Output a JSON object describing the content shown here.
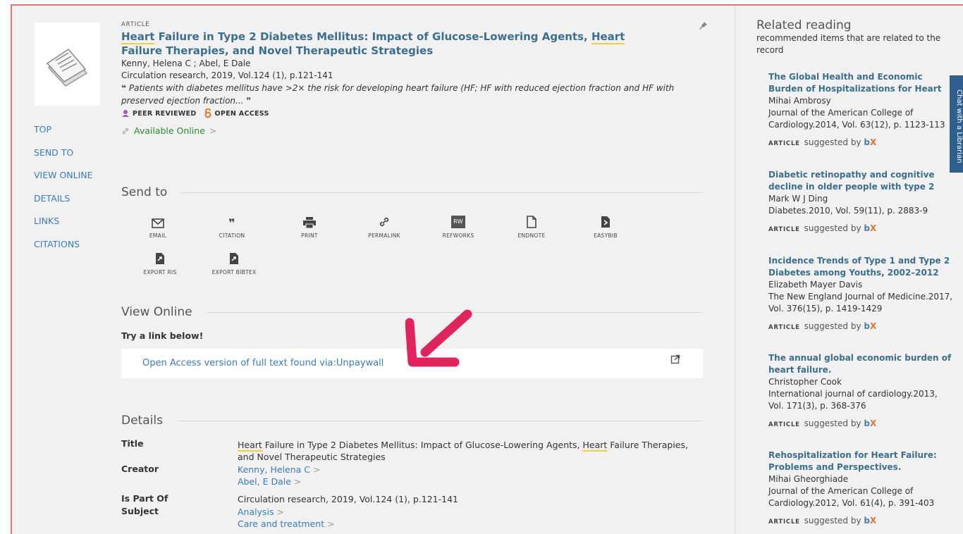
{
  "leftnav": [
    "TOP",
    "SEND TO",
    "VIEW ONLINE",
    "DETAILS",
    "LINKS",
    "CITATIONS"
  ],
  "record": {
    "type": "ARTICLE",
    "title_hl1": "Heart",
    "title_mid": " Failure in Type 2 Diabetes Mellitus: Impact of Glucose-Lowering Agents, ",
    "title_hl2": "Heart",
    "title_end": "Failure Therapies, and Novel Therapeutic Strategies",
    "authors": "Kenny, Helena C ; Abel, E Dale",
    "source": "Circulation research, 2019, Vol.124 (1), p.121-141",
    "snippet": " Patients with diabetes mellitus have >2× the risk for developing heart failure (HF; HF with reduced ejection fraction and HF with preserved ejection fraction... ",
    "open_quote": "❝",
    "close_quote": "❞",
    "badge_peer": "PEER REVIEWED",
    "badge_open": "OPEN ACCESS",
    "availability": "Available Online",
    "availability_chev": ">"
  },
  "send_to": {
    "heading": "Send to",
    "items": [
      "EMAIL",
      "CITATION",
      "PRINT",
      "PERMALINK",
      "REFWORKS",
      "ENDNOTE",
      "EASYBIB",
      "EXPORT RIS",
      "EXPORT BIBTEX"
    ],
    "refworks_badge": "RW"
  },
  "view_online": {
    "heading": "View Online",
    "try": "Try a link below!",
    "link": "Open Access version of full text found via:Unpaywall"
  },
  "details": {
    "heading": "Details",
    "title_label": "Title",
    "title_hl1": "Heart",
    "title_mid": " Failure in Type 2 Diabetes Mellitus: Impact of Glucose-Lowering Agents, ",
    "title_hl2": "Heart",
    "title_end": " Failure Therapies, and Novel Therapeutic Strategies",
    "creator_label": "Creator",
    "creators": [
      "Kenny, Helena C",
      "Abel, E Dale"
    ],
    "ispartof_label": "Is Part Of",
    "ispartof": "Circulation research, 2019, Vol.124 (1), p.121-141",
    "subject_label": "Subject",
    "subjects": [
      "Analysis",
      "Care and treatment"
    ],
    "chev": ">"
  },
  "related": {
    "title": "Related reading",
    "subtitle": "recommended items that are related to the record",
    "suggested_kind": "ARTICLE",
    "suggested_text": "suggested by",
    "bx_b": "b",
    "bx_x": "X",
    "items": [
      {
        "title": "The Global Health and Economic Burden of Hospitalizations for Heart",
        "author": "Mihai Ambrosy",
        "source": "Journal of the American College of Cardiology.2014, Vol. 63(12), p. 1123-113"
      },
      {
        "title": "Diabetic retinopathy and cognitive decline in older people with type 2",
        "author": "Mark W J Ding",
        "source": "Diabetes.2010, Vol. 59(11), p. 2883-9"
      },
      {
        "title": "Incidence Trends of Type 1 and Type 2 Diabetes among Youths, 2002–2012",
        "author": "Elizabeth Mayer Davis",
        "source": "The New England Journal of Medicine.2017, Vol. 376(15), p. 1419-1429"
      },
      {
        "title": "The annual global economic burden of heart failure.",
        "author": "Christopher Cook",
        "source": "International journal of cardiology.2013, Vol. 171(3), p. 368-376"
      },
      {
        "title": "Rehospitalization for Heart Failure: Problems and Perspectives.",
        "author": "Mihai Gheorghiade",
        "source": "Journal of the American College of Cardiology.2012, Vol. 61(4), p. 391-403"
      }
    ]
  },
  "chat_tab": "Chat with a Librarian",
  "colors": {
    "link": "#3a7bbf",
    "title": "#3b6e8f",
    "arrow": "#e0245e",
    "available": "#2f8a2f",
    "highlight": "#f4cf3c"
  }
}
